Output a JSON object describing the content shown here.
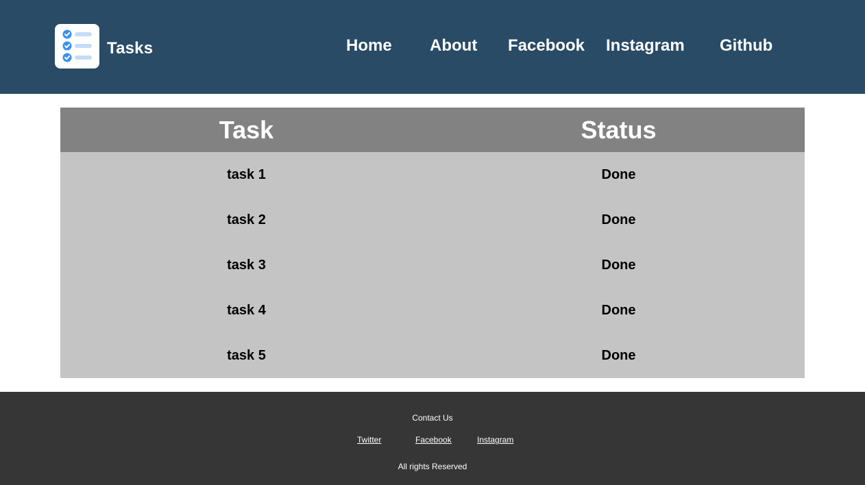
{
  "header": {
    "brand": "Tasks",
    "logo_icon": "task-list-icon",
    "nav": {
      "home": "Home",
      "about": "About",
      "facebook": "Facebook",
      "instagram": "Instagram",
      "github": "Github"
    }
  },
  "table": {
    "columns": [
      "Task",
      "Status"
    ],
    "rows": [
      {
        "task": "task 1",
        "status": "Done"
      },
      {
        "task": "task 2",
        "status": "Done"
      },
      {
        "task": "task 3",
        "status": "Done"
      },
      {
        "task": "task 4",
        "status": "Done"
      },
      {
        "task": "task 5",
        "status": "Done"
      }
    ]
  },
  "footer": {
    "contact": "Contact Us",
    "links": [
      "Twitter",
      "Facebook",
      "Instagram"
    ],
    "rights": "All rights Reserved"
  },
  "colors": {
    "header_bg": "#294b65",
    "table_header_bg": "#828282",
    "table_body_bg": "#c4c4c4",
    "footer_bg": "#363636",
    "logo_accent": "#3b8ff0"
  }
}
